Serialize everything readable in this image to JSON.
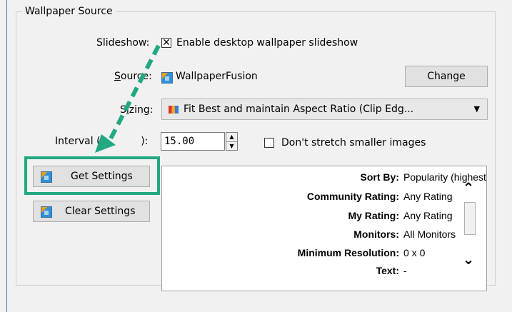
{
  "group": {
    "title": "Wallpaper Source"
  },
  "slideshow": {
    "label": "Slideshow:",
    "checkbox_mark": "✕",
    "checkbox_label": "Enable desktop wallpaper slideshow"
  },
  "source": {
    "label_u": "S",
    "label_rest": "ource:",
    "value": "WallpaperFusion",
    "change_button": "Change"
  },
  "sizing": {
    "label_start": "S",
    "label_u": "i",
    "label_rest": "zing:",
    "value": "Fit Best and maintain Aspect Ratio (Clip Edg..."
  },
  "interval": {
    "label_start": "Interval (",
    "label_hidden": "minutes",
    "label_end": "):",
    "value": "15.00",
    "no_stretch_label": "Don't stretch smaller images"
  },
  "buttons": {
    "get_settings": "Get Settings",
    "clear_settings": "Clear Settings"
  },
  "settings_rows": [
    {
      "key": "Sort By:",
      "value": "Popularity (highest)"
    },
    {
      "key": "Community Rating:",
      "value": "Any Rating"
    },
    {
      "key": "My Rating:",
      "value": "Any Rating"
    },
    {
      "key": "Monitors:",
      "value": "All Monitors"
    },
    {
      "key": "Minimum Resolution:",
      "value": "0 x 0"
    },
    {
      "key": "Text:",
      "value": "-"
    }
  ],
  "colors": {
    "annotation": "#22a883"
  },
  "icons": {
    "source": "app-icon",
    "sizing": "color-swatch-icon",
    "scroll_up": "chevron-up-icon",
    "scroll_down": "chevron-down-icon"
  }
}
